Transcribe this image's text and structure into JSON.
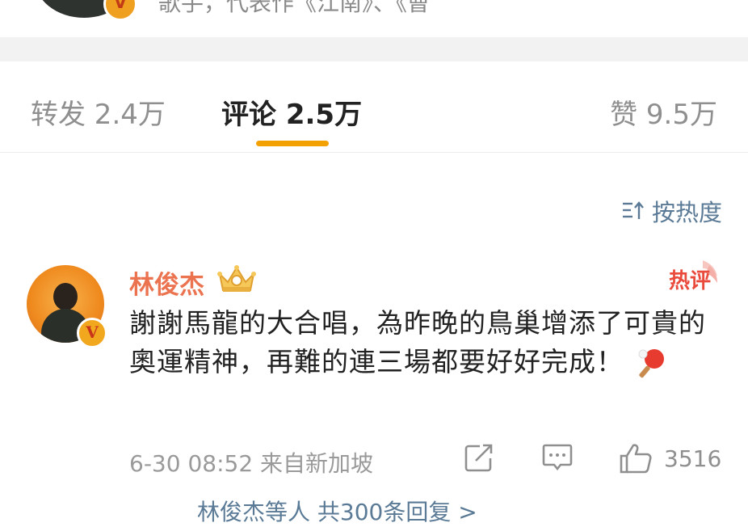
{
  "top": {
    "snippet": "歌手，代表作《江南》、《曹"
  },
  "tabs": [
    {
      "label": "转发 2.4万",
      "active": false
    },
    {
      "label": "评论 2.5万",
      "active": true
    },
    {
      "label": "赞 9.5万",
      "active": false
    }
  ],
  "sort": {
    "label": "按热度",
    "icon": "sort-icon"
  },
  "comment": {
    "author": "林俊杰",
    "badge_letter": "V",
    "hot_label": "热评",
    "text": "謝謝馬龍的大合唱，為昨晚的鳥巢增添了可貴的奧運精神，再難的連三場都要好好完成！",
    "emoji": "ping-pong-icon",
    "meta": "6-30 08:52 来自新加坡",
    "like_count": "3516"
  },
  "footer": {
    "more_text": "林俊杰等人 共300条回复 >"
  },
  "colors": {
    "accent": "#f2a100",
    "author": "#eb7350",
    "link": "#5a7a96",
    "hot": "#e94a3c"
  }
}
